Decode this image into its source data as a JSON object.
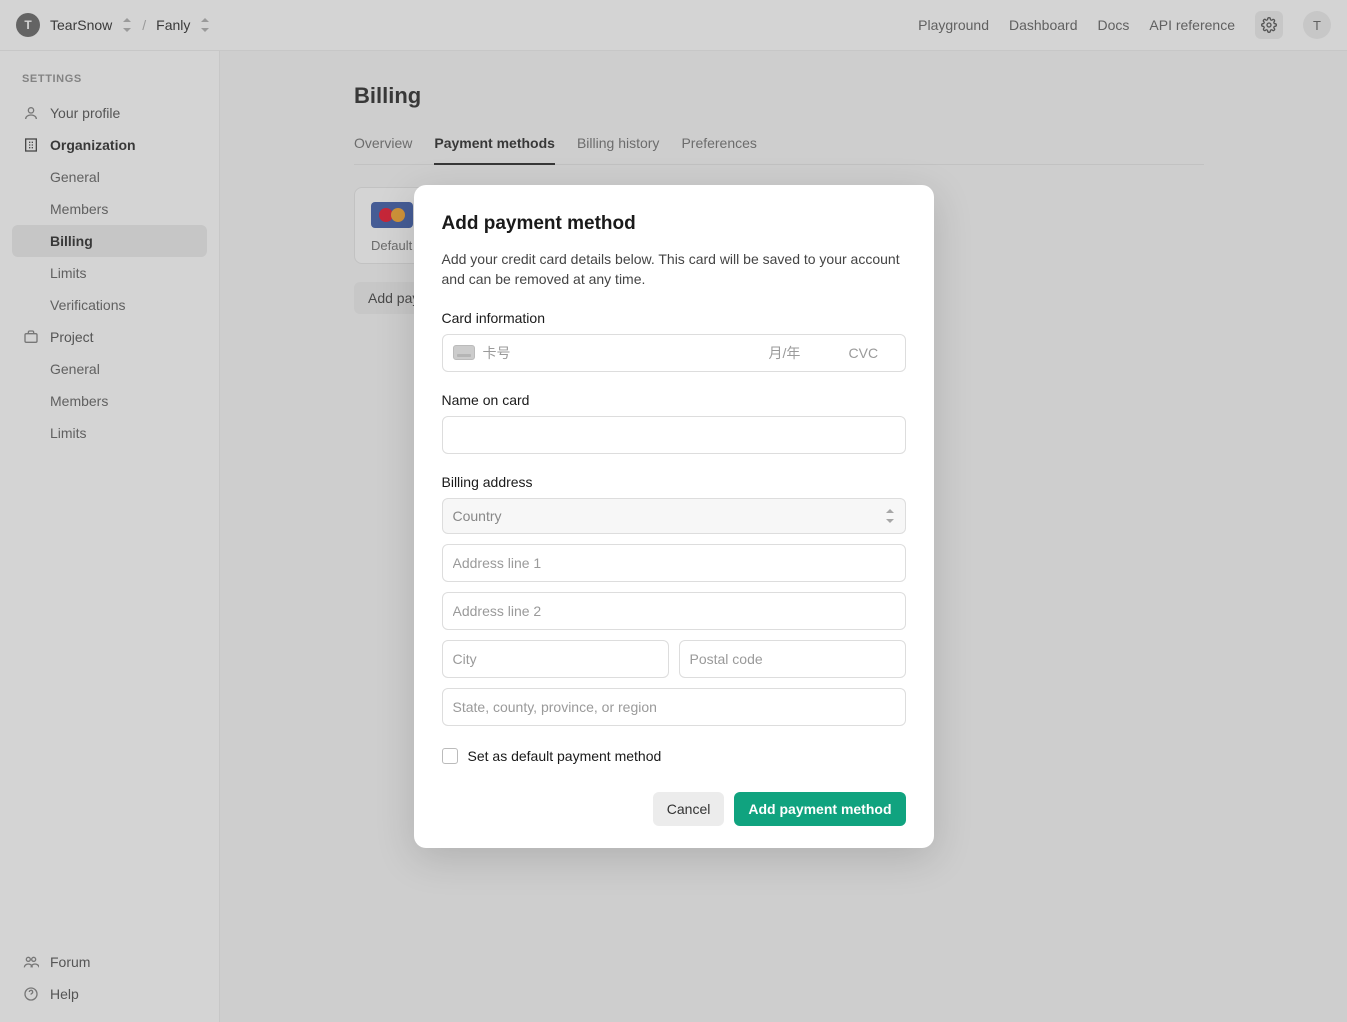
{
  "header": {
    "org_initial": "T",
    "org_name": "TearSnow",
    "project_name": "Fanly",
    "nav": {
      "playground": "Playground",
      "dashboard": "Dashboard",
      "docs": "Docs",
      "api_reference": "API reference"
    },
    "user_initial": "T"
  },
  "sidebar": {
    "heading": "SETTINGS",
    "your_profile": "Your profile",
    "organization": "Organization",
    "org_general": "General",
    "org_members": "Members",
    "org_billing": "Billing",
    "org_limits": "Limits",
    "org_verifications": "Verifications",
    "project": "Project",
    "proj_general": "General",
    "proj_members": "Members",
    "proj_limits": "Limits",
    "forum": "Forum",
    "help": "Help"
  },
  "page": {
    "title": "Billing",
    "tabs": {
      "overview": "Overview",
      "payment_methods": "Payment methods",
      "billing_history": "Billing history",
      "preferences": "Preferences"
    },
    "card_badge": "Default",
    "add_button": "Add payment method"
  },
  "modal": {
    "title": "Add payment method",
    "description": "Add your credit card details below. This card will be saved to your account and can be removed at any time.",
    "card_info_label": "Card information",
    "card_number_placeholder": "卡号",
    "card_expiry_placeholder": "月/年",
    "card_cvc_placeholder": "CVC",
    "name_label": "Name on card",
    "billing_address_label": "Billing address",
    "country_placeholder": "Country",
    "address1_placeholder": "Address line 1",
    "address2_placeholder": "Address line 2",
    "city_placeholder": "City",
    "postal_placeholder": "Postal code",
    "state_placeholder": "State, county, province, or region",
    "default_checkbox_label": "Set as default payment method",
    "cancel": "Cancel",
    "submit": "Add payment method"
  }
}
